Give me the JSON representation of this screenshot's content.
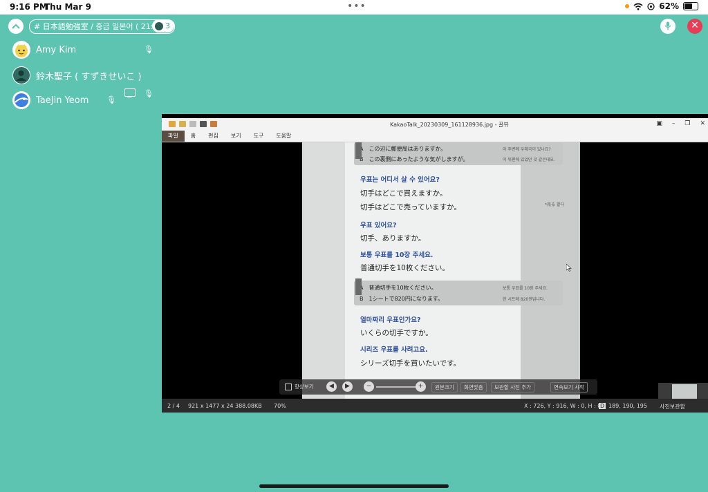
{
  "status_bar": {
    "time": "9:16 PM",
    "date": "Thu Mar 9",
    "more": "•••",
    "battery": "62%",
    "battery_level": 0.62
  },
  "header": {
    "collapse_icon": "chevron-up-icon",
    "room_title": "# 日本語勉強室 / 중급 일본어 ( 21:00...",
    "participant_count": "3",
    "mic_icon": "microphone-icon",
    "close_icon": "close-icon"
  },
  "participants": [
    {
      "name": "Amy Kim",
      "mic": true
    },
    {
      "name": "鈴木聖子 ( すずきせいこ )",
      "mic": false
    },
    {
      "name": "TaeJin Yeom",
      "mic": true,
      "sharing": true
    }
  ],
  "viewer": {
    "title": "KakaoTalk_20230309_161128936.jpg - 꿀뷰",
    "menu": [
      "파일",
      "홈",
      "편집",
      "보기",
      "도구",
      "도움말"
    ],
    "active_menu": "파일",
    "window_controls": [
      "▣",
      "–",
      "❐",
      "✕"
    ],
    "page": {
      "box1_a": "A　この辺に郵便局はありますか。",
      "box1_b": "B　この裏側にあったような気がしますが。",
      "box1_ra": "이 주변에 우체국이 있나요?",
      "box1_rb": "이 뒤편에 있었던 것 같은데요.",
      "k1": "우표는 어디서 살 수 있어요?",
      "j1": "切手はどこで買えますか。",
      "j2": "切手はどこで売っていますか。",
      "note": "*売る 팔다",
      "k2": "우표 있어요?",
      "j3": "切手、ありますか。",
      "k3": "보통 우표를 10장 주세요.",
      "j4": "普通切手を10枚ください。",
      "box2_a": "A　普通切手を10枚ください。",
      "box2_b": "B　1シートで820円になります。",
      "box2_ra": "보통 우표를 10장 주세요.",
      "box2_rb": "한 시트에 820엔입니다.",
      "k4": "얼마짜리 우표인가요?",
      "j5": "いくらの切手ですか。",
      "k5": "시리즈 우표를 사려고요.",
      "j6": "シリーズ切手を買いたいです。"
    },
    "controls": {
      "always_view": "항상보기",
      "fit_size": "원본크기",
      "fit_screen": "화면맞춤",
      "add_album": "보관할 사진 추가",
      "slideshow": "연속보기 시작"
    },
    "status": {
      "page": "2 / 4",
      "dims": "921 x 1477 x 24",
      "size": "388.08KB",
      "zoom": "70%",
      "coords": "X : 726, Y : 916, W : 0, H : 0",
      "color_tag": "D",
      "rgb": "189, 190, 195",
      "album": "사진보관함"
    }
  }
}
